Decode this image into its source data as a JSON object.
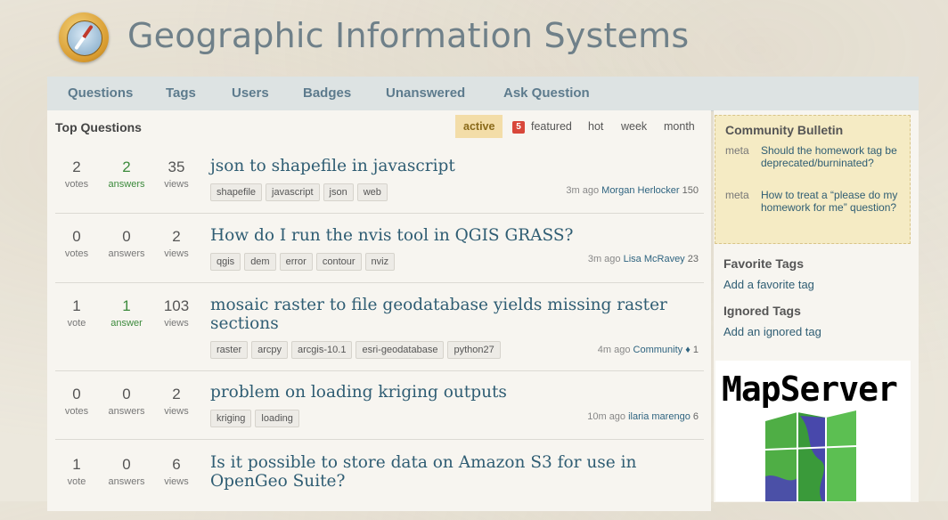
{
  "site": {
    "title": "Geographic Information Systems"
  },
  "nav": [
    "Questions",
    "Tags",
    "Users",
    "Badges",
    "Unanswered",
    "Ask Question"
  ],
  "main": {
    "section_title": "Top Questions",
    "tabs": {
      "active": "active",
      "featured_count": "5",
      "featured": "featured",
      "hot": "hot",
      "week": "week",
      "month": "month"
    },
    "questions": [
      {
        "votes": "2",
        "votes_label": "votes",
        "answers": "2",
        "answers_label": "answers",
        "views": "35",
        "views_label": "views",
        "title": "json to shapefile in javascript",
        "tags": [
          "shapefile",
          "javascript",
          "json",
          "web"
        ],
        "time": "3m ago",
        "user": "Morgan Herlocker",
        "rep": "150"
      },
      {
        "votes": "0",
        "votes_label": "votes",
        "answers": "0",
        "answers_label": "answers",
        "views": "2",
        "views_label": "views",
        "title": "How do I run the nvis tool in QGIS GRASS?",
        "tags": [
          "qgis",
          "dem",
          "error",
          "contour",
          "nviz"
        ],
        "time": "3m ago",
        "user": "Lisa McRavey",
        "rep": "23"
      },
      {
        "votes": "1",
        "votes_label": "vote",
        "answers": "1",
        "answers_label": "answer",
        "views": "103",
        "views_label": "views",
        "title": "mosaic raster to file geodatabase yields missing raster sections",
        "tags": [
          "raster",
          "arcpy",
          "arcgis-10.1",
          "esri-geodatabase",
          "python27"
        ],
        "time": "4m ago",
        "user": "Community ♦",
        "rep": "1"
      },
      {
        "votes": "0",
        "votes_label": "votes",
        "answers": "0",
        "answers_label": "answers",
        "views": "2",
        "views_label": "views",
        "title": "problem on loading kriging outputs",
        "tags": [
          "kriging",
          "loading"
        ],
        "time": "10m ago",
        "user": "ilaria marengo",
        "rep": "6"
      },
      {
        "votes": "1",
        "votes_label": "vote",
        "answers": "0",
        "answers_label": "answers",
        "views": "6",
        "views_label": "views",
        "title": "Is it possible to store data on Amazon S3 for use in OpenGeo Suite?",
        "tags": [],
        "time": "",
        "user": "",
        "rep": ""
      }
    ]
  },
  "sidebar": {
    "bulletin_title": "Community Bulletin",
    "bulletin": [
      {
        "kind": "meta",
        "text": "Should the homework tag be deprecated/burninated?"
      },
      {
        "kind": "meta",
        "text": "How to treat a “please do my homework for me” question?"
      }
    ],
    "favorite_title": "Favorite Tags",
    "favorite_link": "Add a favorite tag",
    "ignored_title": "Ignored Tags",
    "ignored_link": "Add an ignored tag",
    "ad_text": "MapServer"
  },
  "colors": {
    "link": "#2f5d73",
    "nav_bg": "#dde3e3",
    "active_tab": "#f3dda8",
    "answer_green": "#3c8a3c"
  }
}
